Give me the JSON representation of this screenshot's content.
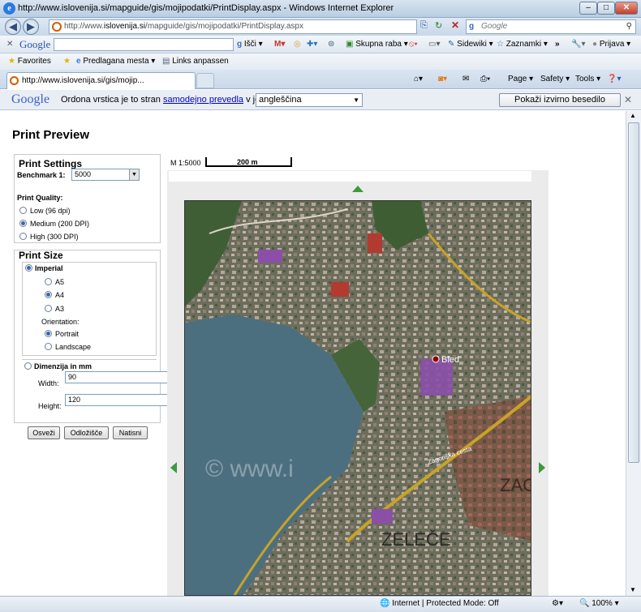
{
  "window": {
    "title": "http://www.islovenija.si/mapguide/gis/mojipodatki/PrintDisplay.aspx - Windows Internet Explorer"
  },
  "address": {
    "url_prefix": "http://www.",
    "url_domain": "islovenija.si",
    "url_path": "/mapguide/gis/mojipodatki/PrintDisplay.aspx",
    "search_placeholder": "Google"
  },
  "google_toolbar": {
    "logo": "Google",
    "search_label": "Išči",
    "share_label": "Skupna raba",
    "sidewiki_label": "Sidewiki",
    "bookmarks_label": "Zaznamki",
    "signin_label": "Prijava"
  },
  "favorites": {
    "favorites_label": "Favorites",
    "suggested_label": "Predlagana mesta",
    "links_label": "Links anpassen"
  },
  "tab": {
    "label": "http://www.islovenija.si/gis/mojip..."
  },
  "command_bar": {
    "page_label": "Page",
    "safety_label": "Safety",
    "tools_label": "Tools"
  },
  "translate_bar": {
    "logo": "Google",
    "message_prefix": "Ordona vrstica je to stran",
    "message_link": "samodejno prevedla",
    "message_suffix": "v jezik:",
    "language": "angleščina",
    "show_original_label": "Pokaži izvirno besedilo"
  },
  "page": {
    "title": "Print Preview",
    "print_settings": {
      "title": "Print Settings",
      "benchmark_label": "Benchmark 1:",
      "benchmark_value": "5000",
      "quality_label": "Print Quality:",
      "quality_options": [
        "Low (96 dpi)",
        "Medium (200 DPI)",
        "High (300 DPI)"
      ],
      "quality_selected": "Medium (200 DPI)"
    },
    "print_size": {
      "title": "Print Size",
      "imperial_label": "Imperial",
      "paper_options": [
        "A5",
        "A4",
        "A3"
      ],
      "paper_selected": "A4",
      "orientation_label": "Orientation:",
      "orientation_options": [
        "Portrait",
        "Landscape"
      ],
      "orientation_selected": "Portrait",
      "dimension_label": "Dimenzija in mm",
      "width_label": "Width:",
      "width_value": "90",
      "height_label": "Height:",
      "height_value": "120"
    },
    "buttons": {
      "refresh": "Osveži",
      "clipboard": "Odložišče",
      "print": "Natisni"
    },
    "map": {
      "scale_label": "M 1:5000",
      "scale_bar_label": "200 m",
      "place_label": "Bled",
      "watermark": "© www.i",
      "street_label": "Zagoriška cesta",
      "area_label_1": "ZELEČE",
      "area_label_2": "ZAG",
      "lake_color": "#4c6f80",
      "road_color": "#c8a326"
    }
  },
  "status": {
    "zone": "Internet | Protected Mode: Off",
    "zoom": "100%"
  }
}
